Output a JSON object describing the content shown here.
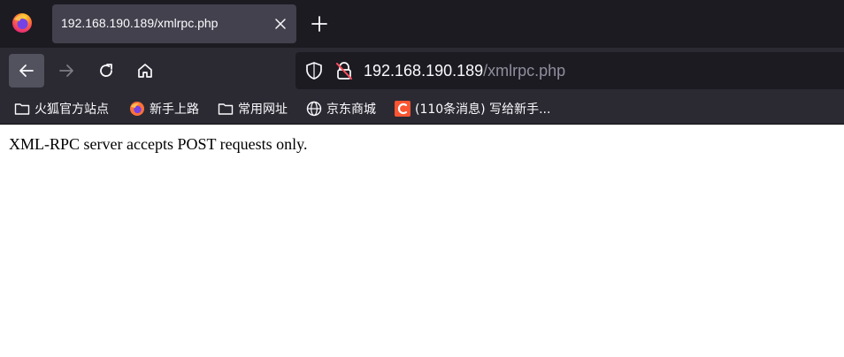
{
  "tabs": [
    {
      "title": "192.168.190.189/xmlrpc.php",
      "active": true
    }
  ],
  "urlbar": {
    "host": "192.168.190.189",
    "path": "/xmlrpc.php"
  },
  "bookmarks": [
    {
      "label": "火狐官方站点",
      "icon": "folder-icon"
    },
    {
      "label": "新手上路",
      "icon": "firefox-icon"
    },
    {
      "label": "常用网址",
      "icon": "folder-icon"
    },
    {
      "label": "京东商城",
      "icon": "globe-icon"
    },
    {
      "label": "(110条消息) 写给新手...",
      "icon": "csdn-icon"
    }
  ],
  "page": {
    "message": "XML-RPC server accepts POST requests only."
  },
  "colors": {
    "tabbar": "#1c1b22",
    "toolbar": "#2b2a33",
    "active_tab": "#42414d",
    "text": "#fbfbfe",
    "url_path": "#8f8f9d",
    "csdn": "#fc5531"
  }
}
